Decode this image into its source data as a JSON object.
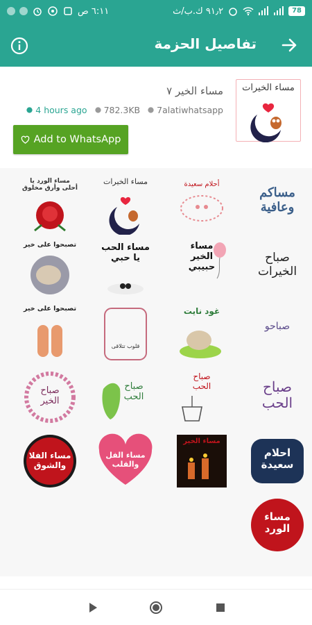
{
  "status_bar": {
    "time": "٦:١١ ص",
    "network_speed": "٩١٫٢ ك.ب/ث",
    "battery": "78"
  },
  "app_bar": {
    "title": "تفاصيل الحزمة",
    "back_icon": "arrow-right-icon",
    "info_icon": "info-icon"
  },
  "pack": {
    "tray_label": "مساء الخيرات",
    "name": "مساء الخير ٧",
    "publisher": "7alatiwhatsapp",
    "size": "782.3KB",
    "updated": "4 hours ago",
    "add_button": "Add to WhatsApp"
  },
  "stickers": [
    {
      "text": "مساء الورد يا\nأحلى وأرق مخلوق"
    },
    {
      "text": "مساء الخيرات"
    },
    {
      "text": "أحلام سعيدة"
    },
    {
      "text": "مساكم\nوعافية"
    },
    {
      "text": "تصبحوا على خير"
    },
    {
      "text": "مساء الحب\nيا حبي"
    },
    {
      "text": "مساء\nالخير\nحبيبي"
    },
    {
      "text": "صباح\nالخيرات"
    },
    {
      "text": "تصبحوا على خير"
    },
    {
      "text": "قلوب تتلاقى"
    },
    {
      "text": "غود نايت"
    },
    {
      "text": "صباحو"
    },
    {
      "text": "صباح\nالخير"
    },
    {
      "text": "صباح\nالحب"
    },
    {
      "text": "صباح\nالحب"
    },
    {
      "text": "صباح\nالحب"
    },
    {
      "text": "مساء الفلا\nوالشوق"
    },
    {
      "text": "مساء الفل\nوالقلب"
    },
    {
      "text": "مساء الخير"
    },
    {
      "text": "احلام\nسعيدة"
    },
    {
      "text": "مساء\nالورد"
    }
  ],
  "colors": {
    "primary": "#2aa592",
    "add_button": "#56a323"
  },
  "nav": {
    "back_icon": "triangle-back-icon",
    "home_icon": "circle-home-icon",
    "recents_icon": "square-recents-icon"
  }
}
